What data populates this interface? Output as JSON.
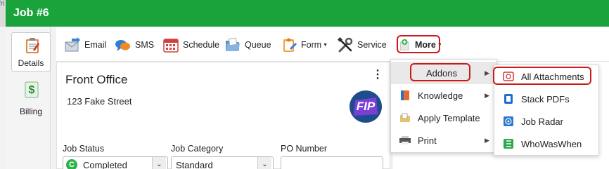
{
  "window": {
    "title": "Job #6",
    "left_fragment": "fri"
  },
  "sidebar": {
    "items": [
      {
        "label": "Details"
      },
      {
        "label": "Billing"
      }
    ]
  },
  "toolbar": {
    "items": [
      {
        "label": "Email"
      },
      {
        "label": "SMS"
      },
      {
        "label": "Schedule"
      },
      {
        "label": "Queue"
      },
      {
        "label": "Form"
      },
      {
        "label": "Service"
      },
      {
        "label": "More"
      }
    ]
  },
  "job": {
    "name": "Front Office",
    "address": "123 Fake Street",
    "logo_text": "FIP",
    "fields": [
      {
        "label": "Job Status",
        "value": "Completed",
        "status_letter": "C"
      },
      {
        "label": "Job Category",
        "value": "Standard"
      },
      {
        "label": "PO Number",
        "value": ""
      }
    ]
  },
  "more_menu": {
    "items": [
      {
        "label": "Addons"
      },
      {
        "label": "Knowledge"
      },
      {
        "label": "Apply Template"
      },
      {
        "label": "Print"
      }
    ]
  },
  "addons_menu": {
    "items": [
      {
        "label": "All Attachments"
      },
      {
        "label": "Stack PDFs"
      },
      {
        "label": "Job Radar"
      },
      {
        "label": "WhoWasWhen"
      }
    ]
  },
  "colors": {
    "header_green": "#1aa33a",
    "highlight_red": "#cc1a1a",
    "status_green": "#2db34a"
  }
}
